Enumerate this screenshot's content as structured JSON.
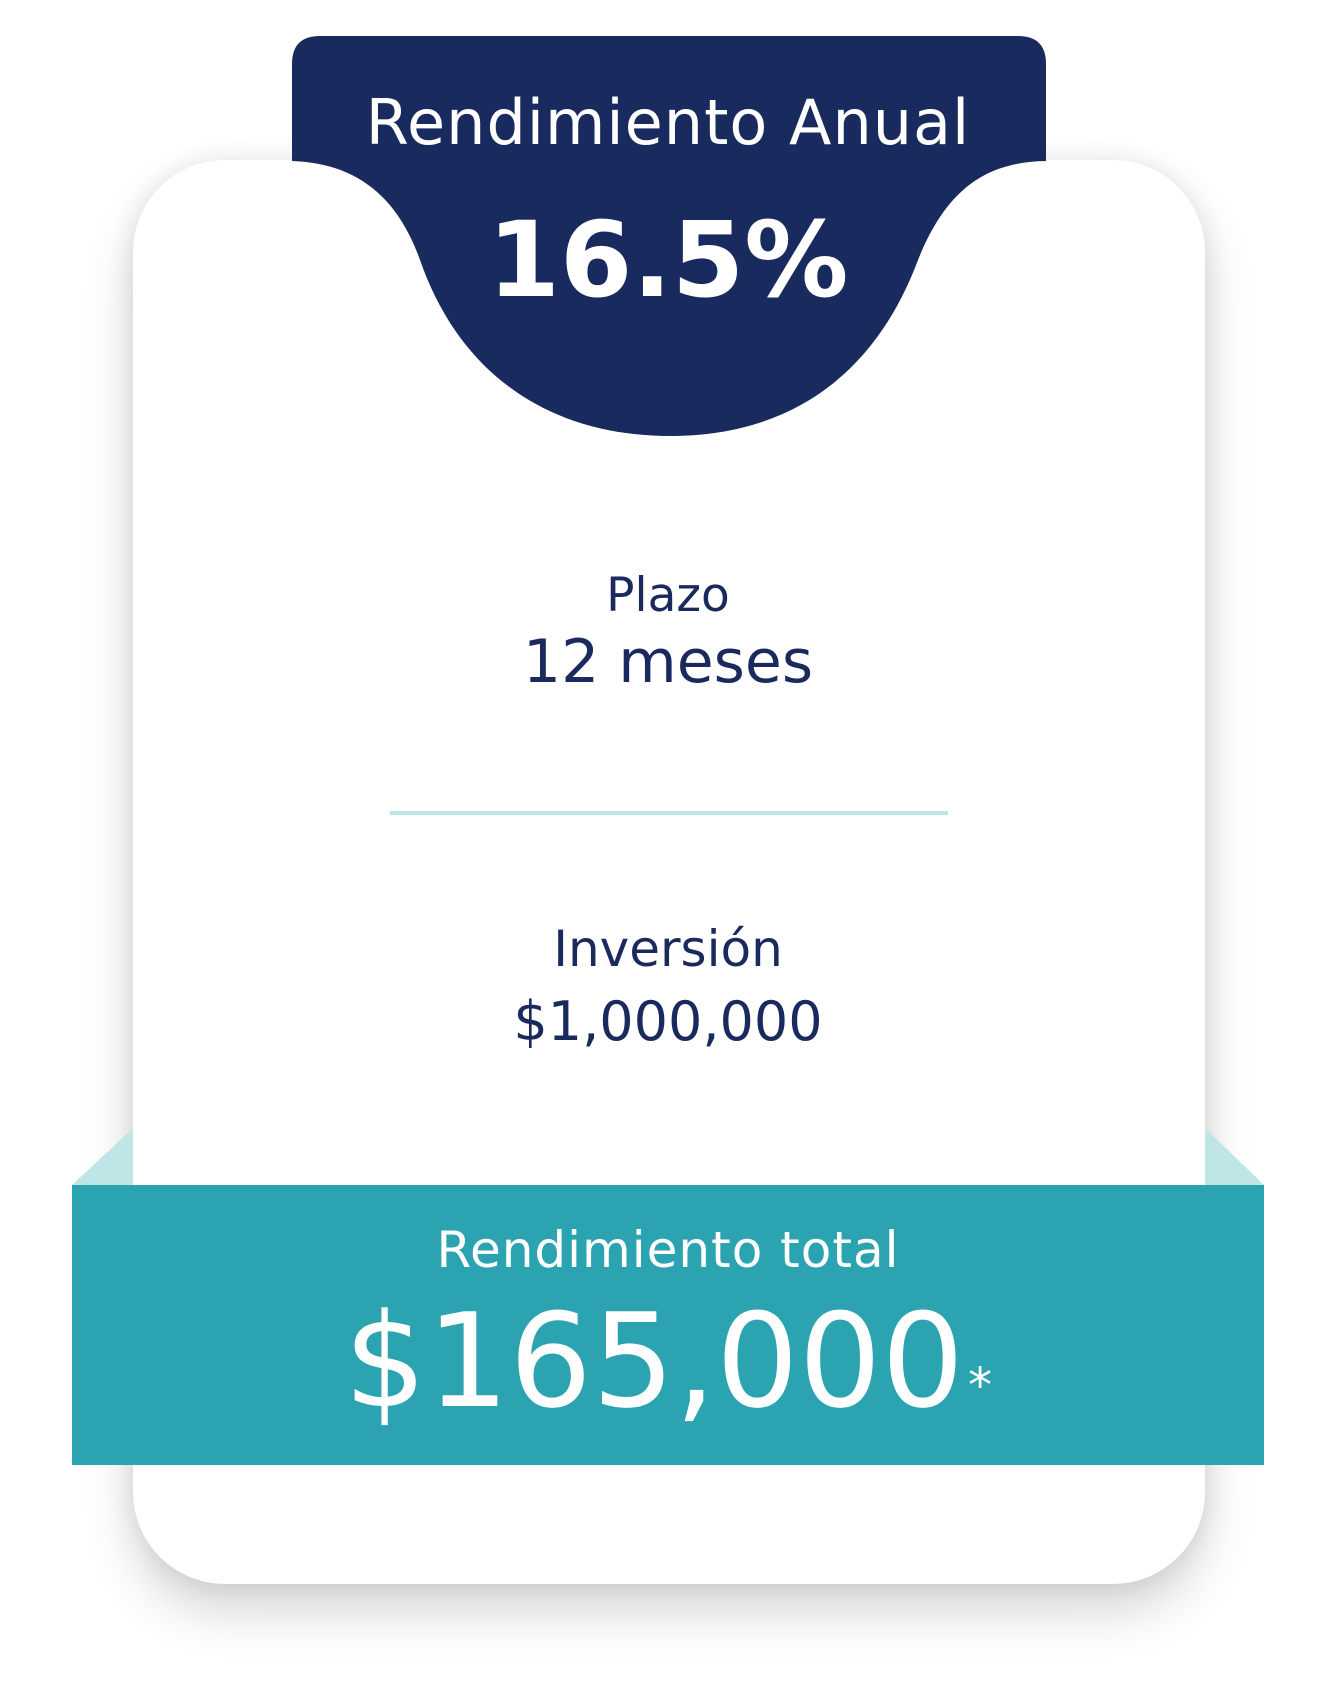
{
  "header": {
    "title": "Rendimiento Anual",
    "rate": "16.5%"
  },
  "plazo": {
    "label": "Plazo",
    "value": "12 meses"
  },
  "inversion": {
    "label": "Inversión",
    "value": "$1,000,000"
  },
  "total": {
    "label": "Rendimiento total",
    "value": "$165,000",
    "footnote_mark": "*"
  },
  "colors": {
    "navy": "#192a5f",
    "teal": "#2ba3b1",
    "light_teal": "#bfe6e6",
    "card": "#ffffff"
  }
}
